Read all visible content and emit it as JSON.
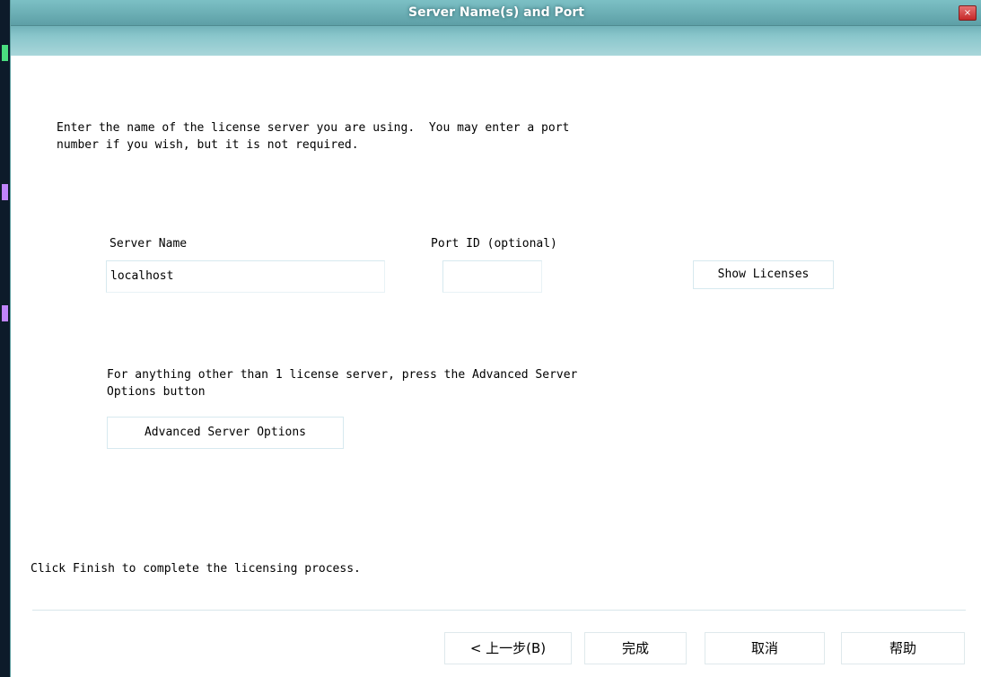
{
  "window": {
    "title": "Server Name(s) and Port",
    "close_label": "×"
  },
  "content": {
    "intro_line1": "Enter the name of the license server you are using.  You may enter a port",
    "intro_line2": "number if you wish, but it is not required.",
    "server_name_label": "Server Name",
    "server_name_value": "localhost",
    "port_label": "Port ID (optional)",
    "port_value": "",
    "show_licenses_label": "Show Licenses",
    "advanced_line1": "For anything other than 1 license server, press the Advanced Server",
    "advanced_line2": "Options button",
    "advanced_button_label": "Advanced Server Options",
    "finish_hint": "Click Finish to complete the licensing process."
  },
  "footer": {
    "back_label": "< 上一步(B)",
    "finish_label": "完成",
    "cancel_label": "取消",
    "help_label": "帮助"
  },
  "colors": {
    "titlebar": "#5fa3ab",
    "close_button": "#c62828",
    "desktop": "#0d1b2a"
  }
}
